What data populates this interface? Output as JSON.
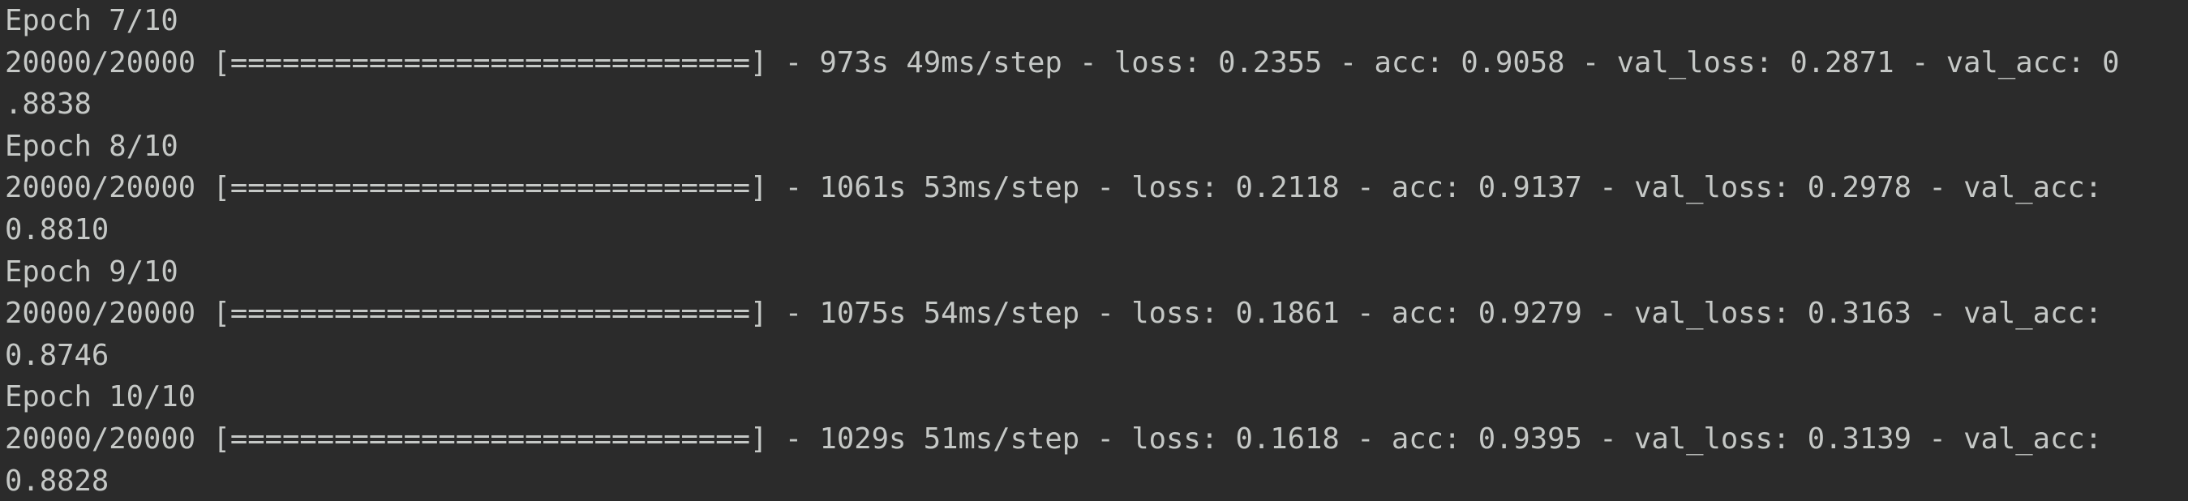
{
  "console": {
    "lines": [
      "Epoch 7/10",
      "20000/20000 [==============================] - 973s 49ms/step - loss: 0.2355 - acc: 0.9058 - val_loss: 0.2871 - val_acc: 0",
      ".8838",
      "Epoch 8/10",
      "20000/20000 [==============================] - 1061s 53ms/step - loss: 0.2118 - acc: 0.9137 - val_loss: 0.2978 - val_acc:",
      "0.8810",
      "Epoch 9/10",
      "20000/20000 [==============================] - 1075s 54ms/step - loss: 0.1861 - acc: 0.9279 - val_loss: 0.3163 - val_acc:",
      "0.8746",
      "Epoch 10/10",
      "20000/20000 [==============================] - 1029s 51ms/step - loss: 0.1618 - acc: 0.9395 - val_loss: 0.3139 - val_acc:",
      "0.8828"
    ]
  },
  "colors": {
    "background": "#2b2b2b",
    "text": "#c5c8c6"
  }
}
